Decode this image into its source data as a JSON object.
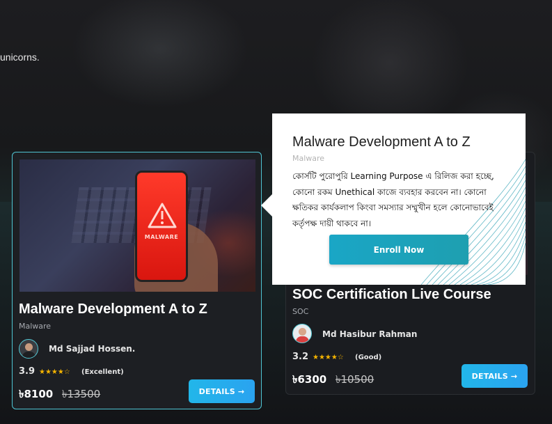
{
  "hero": {
    "text": "unicorns."
  },
  "courses": [
    {
      "title": "Malware Development A to Z",
      "category": "Malware",
      "instructor": "Md Sajjad Hossen.",
      "rating": "3.9",
      "stars": "★★★★☆",
      "rating_text": "(Excellent)",
      "price": "৳8100",
      "old_price": "৳13500",
      "details_label": "DETAILS →",
      "image_label": "MALWARE"
    },
    {
      "title": "SOC Certification Live Course",
      "category": "SOC",
      "instructor": "Md Hasibur Rahman",
      "rating": "3.2",
      "stars": "★★★★☆",
      "rating_text": "(Good)",
      "price": "৳6300",
      "old_price": "৳10500",
      "details_label": "DETAILS →"
    }
  ],
  "popover": {
    "title": "Malware Development A to Z",
    "category": "Malware",
    "description": "কোর্সটি পুরোপুরি Learning Purpose এ রিলিজ করা হচ্ছে, কোনো রকম Unethical কাজে ব্যবহার করবেন না। কোনো ক্ষতিকর কার্যকলাপ কিংবা সমস্যার সম্মুখীন হলে কোনোভাবেই কর্তৃপক্ষ দায়ী থাকবে না।",
    "enroll_label": "Enroll Now"
  },
  "colors": {
    "accent": "#22b6e9",
    "card_border": "#4fc6d4",
    "star": "#f5b400",
    "enroll": "#1aa6c6"
  }
}
